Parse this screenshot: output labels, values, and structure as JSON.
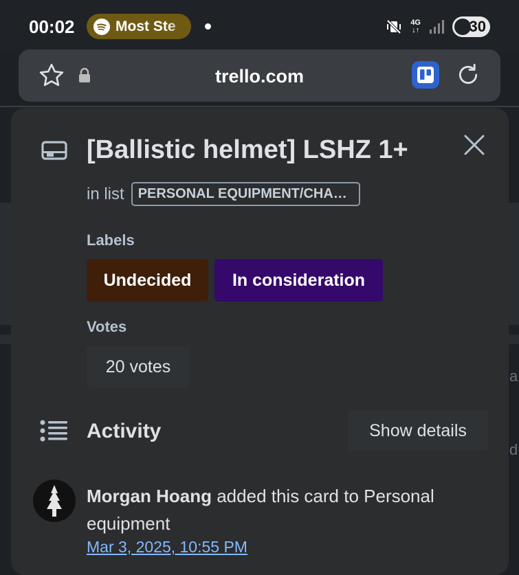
{
  "status_bar": {
    "time": "00:02",
    "media_label": "Most Ste",
    "network_top": "4G",
    "network_bottom": "↓↑",
    "battery": "30"
  },
  "browser": {
    "url": "trello.com"
  },
  "background": {
    "right_fragment_1": "a",
    "right_fragment_2": "d"
  },
  "card": {
    "title": "[Ballistic helmet] LSHZ 1+",
    "in_list_prefix": "in list",
    "list_name": "PERSONAL EQUIPMENT/CHA…",
    "labels_heading": "Labels",
    "labels": [
      {
        "text": "Undecided",
        "color": "#3f1f0a"
      },
      {
        "text": "In consideration",
        "color": "#35096b"
      }
    ],
    "votes_heading": "Votes",
    "votes_label": "20 votes"
  },
  "activity": {
    "heading": "Activity",
    "show_details": "Show details",
    "entries": [
      {
        "user": "Morgan Hoang",
        "action": " added this card to Personal equipment",
        "date": "Mar 3, 2025, 10:55 PM"
      }
    ]
  },
  "colors": {
    "accent_link": "#85b8ff",
    "trello_blue": "#2f62ce"
  }
}
